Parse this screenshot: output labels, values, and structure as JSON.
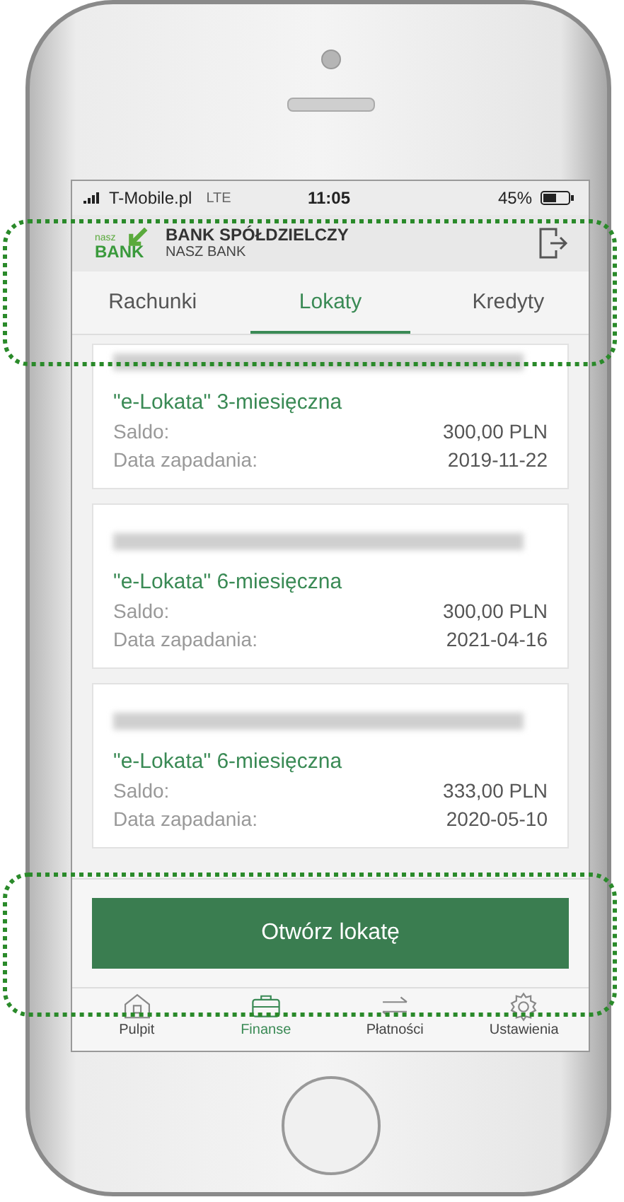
{
  "status_bar": {
    "carrier": "T-Mobile.pl",
    "network": "LTE",
    "time": "11:05",
    "battery": "45%"
  },
  "header": {
    "logo_small": "nasz",
    "logo_big": "BANK",
    "bank_name": "BANK SPÓŁDZIELCZY",
    "bank_subname": "NASZ BANK"
  },
  "tabs": [
    {
      "label": "Rachunki",
      "selected": false
    },
    {
      "label": "Lokaty",
      "selected": true
    },
    {
      "label": "Kredyty",
      "selected": false
    }
  ],
  "deposits": [
    {
      "title": "\"e-Lokata\" 3-miesięczna",
      "balance_label": "Saldo:",
      "balance": "300,00 PLN",
      "date_label": "Data zapadania:",
      "date": "2019-11-22"
    },
    {
      "title": "\"e-Lokata\" 6-miesięczna",
      "balance_label": "Saldo:",
      "balance": "300,00 PLN",
      "date_label": "Data zapadania:",
      "date": "2021-04-16"
    },
    {
      "title": "\"e-Lokata\" 6-miesięczna",
      "balance_label": "Saldo:",
      "balance": "333,00 PLN",
      "date_label": "Data zapadania:",
      "date": "2020-05-10"
    }
  ],
  "open_button": "Otwórz lokatę",
  "bottom_nav": [
    {
      "label": "Pulpit",
      "selected": false
    },
    {
      "label": "Finanse",
      "selected": true
    },
    {
      "label": "Płatności",
      "selected": false
    },
    {
      "label": "Ustawienia",
      "selected": false
    }
  ]
}
